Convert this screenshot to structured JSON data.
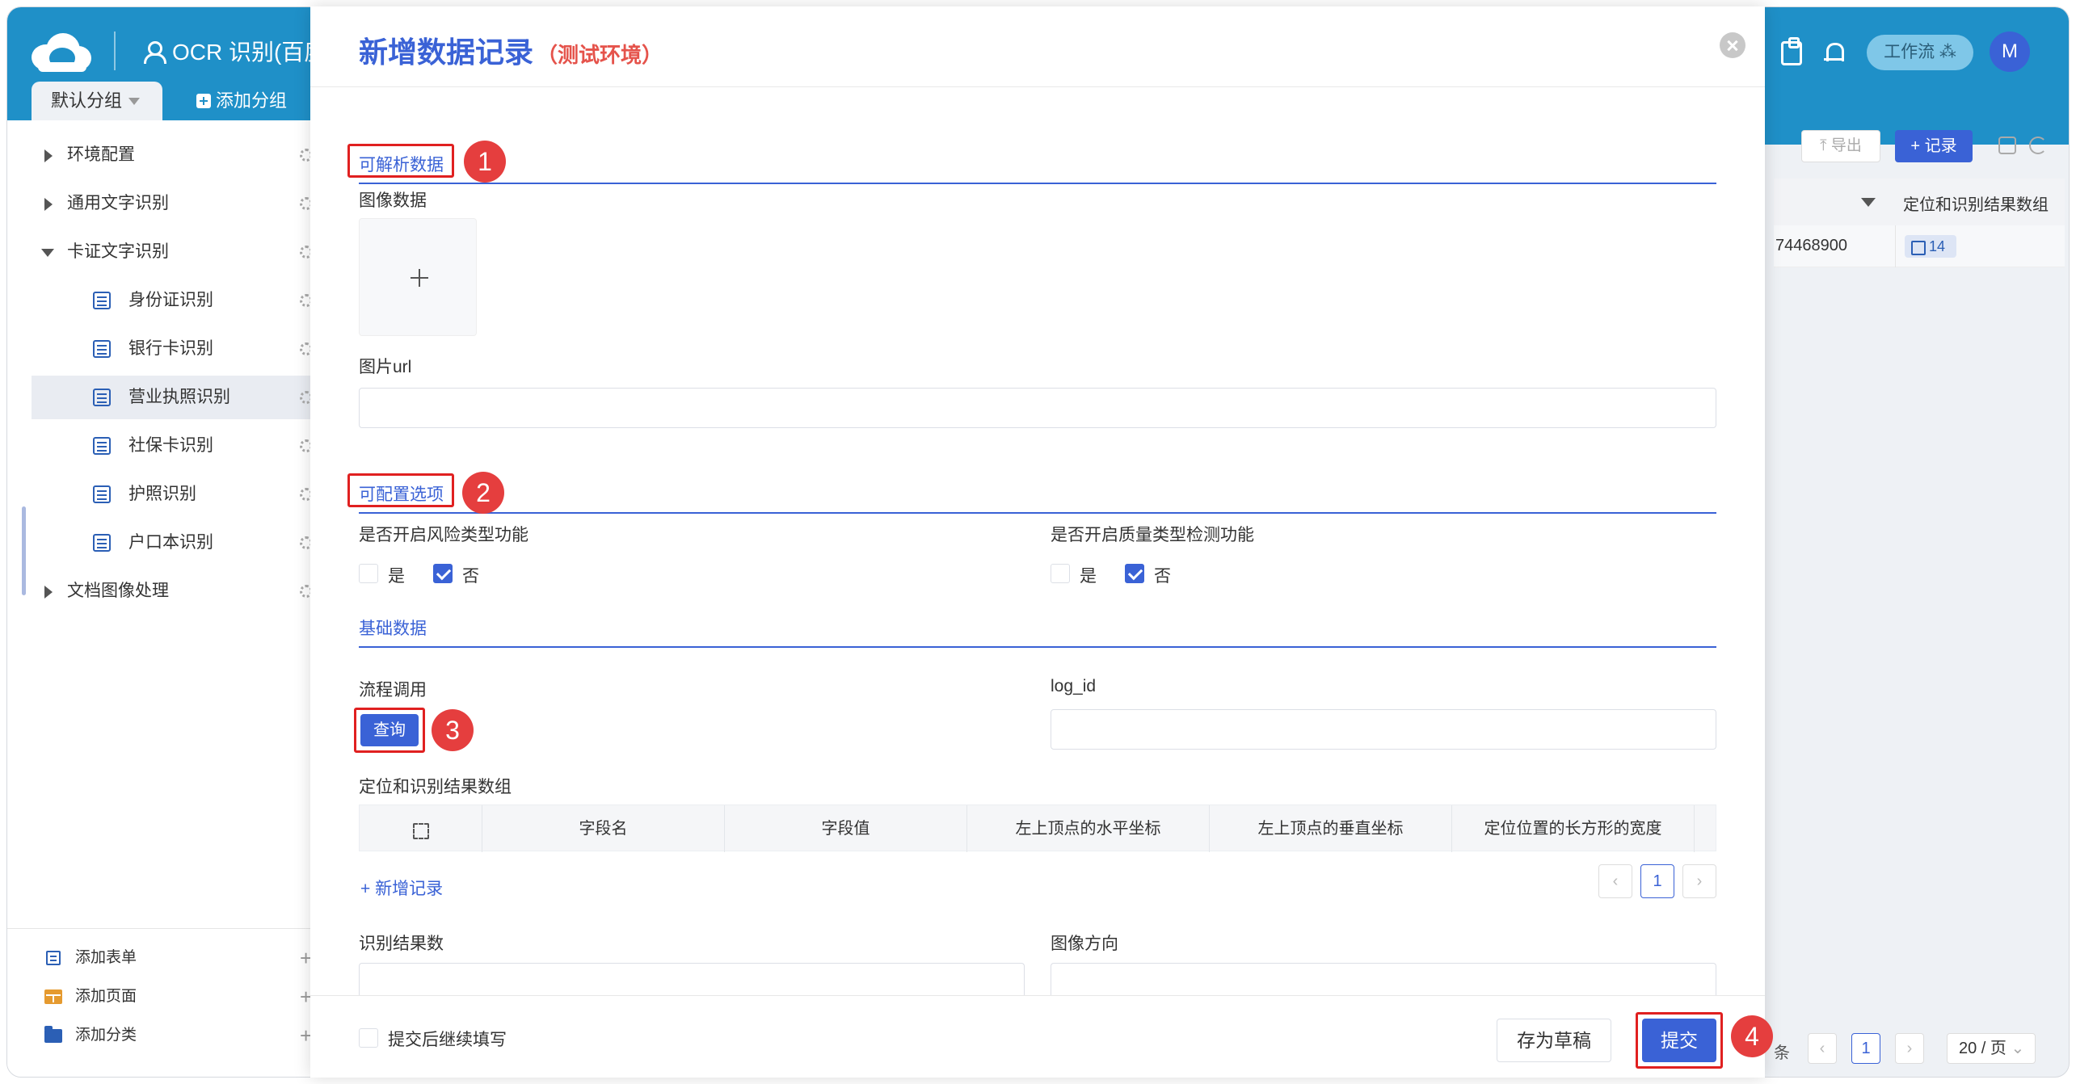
{
  "header": {
    "app_title": "OCR 识别(百度",
    "workflow_label": "工作流 ⁂",
    "avatar_letter": "M",
    "tabs": {
      "default_group": "默认分组",
      "add_group": "添加分组"
    }
  },
  "sidebar": {
    "items": [
      {
        "label": "环境配置"
      },
      {
        "label": "通用文字识别"
      },
      {
        "label": "卡证文字识别"
      },
      {
        "label": "身份证识别"
      },
      {
        "label": "银行卡识别"
      },
      {
        "label": "营业执照识别"
      },
      {
        "label": "社保卡识别"
      },
      {
        "label": "护照识别"
      },
      {
        "label": "户口本识别"
      },
      {
        "label": "文档图像处理"
      }
    ],
    "bottom": {
      "add_form": "添加表单",
      "add_page": "添加页面",
      "add_category": "添加分类"
    }
  },
  "background": {
    "toolbar": {
      "export": "导出",
      "record": "+ 记录"
    },
    "table": {
      "column_header": "定位和识别结果数组",
      "row_number": "74468900",
      "badge_count": "14"
    },
    "pager": {
      "tiao": "条",
      "current_page": "1",
      "page_size": "20 / 页"
    }
  },
  "modal": {
    "title": "新增数据记录",
    "env": "（测试环境）",
    "sections": {
      "parsable": "可解析数据",
      "configurable": "可配置选项",
      "basic": "基础数据"
    },
    "fields": {
      "image_data": "图像数据",
      "image_url": "图片url",
      "risk_type": "是否开启风险类型功能",
      "quality_type": "是否开启质量类型检测功能",
      "yes": "是",
      "no": "否",
      "flow_call": "流程调用",
      "query_button": "查询",
      "log_id": "log_id",
      "result_array": "定位和识别结果数组",
      "result_count": "识别结果数",
      "image_direction": "图像方向"
    },
    "sub_table": {
      "columns": [
        "字段名",
        "字段值",
        "左上顶点的水平坐标",
        "左上顶点的垂直坐标",
        "定位位置的长方形的宽度"
      ],
      "add_record": "+ 新增记录",
      "current_page": "1"
    },
    "footer": {
      "continue_label": "提交后继续填写",
      "draft": "存为草稿",
      "submit": "提交"
    },
    "markers": [
      "1",
      "2",
      "3",
      "4"
    ]
  }
}
